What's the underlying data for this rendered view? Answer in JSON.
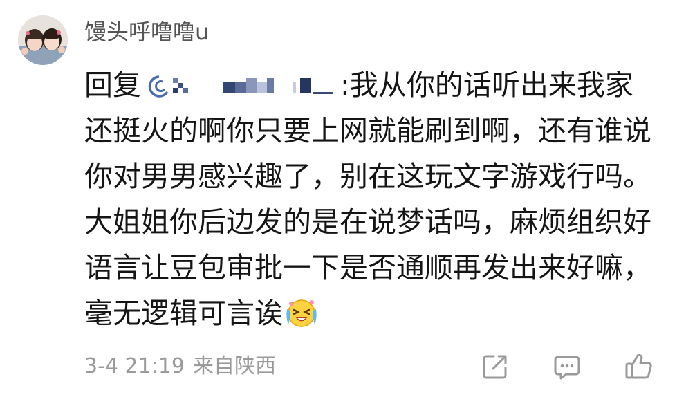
{
  "comment": {
    "username": "馒头呼噜噜u",
    "reply_prefix": "回复",
    "reply_colon": ":",
    "body": "我从你的话听出来我家还挺火的啊你只要上网就能刷到啊，还有谁说你对男男感兴趣了，别在这玩文字游戏行吗。大姐姐你后边发的是在说梦话吗，麻烦组织好语言让豆包审批一下是否通顺再发出来好嘛，毫无逻辑可言诶",
    "emoji": "laughing-crying-emoji",
    "timestamp": "3-4 21:19",
    "location": "来自陕西"
  },
  "actions": [
    {
      "name": "share",
      "icon": "share-icon"
    },
    {
      "name": "comment",
      "icon": "comment-icon"
    },
    {
      "name": "like",
      "icon": "thumbs-up-icon"
    }
  ],
  "colors": {
    "text": "#151515",
    "username": "#555555",
    "meta": "#9a9a9a",
    "icon": "#9a9a9a"
  }
}
